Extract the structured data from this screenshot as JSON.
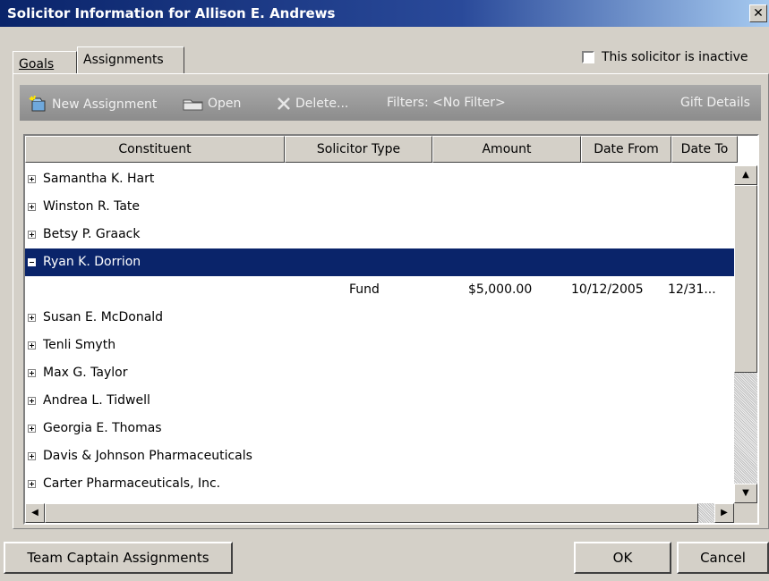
{
  "window": {
    "title": "Solicitor Information for Allison E. Andrews",
    "close_glyph": "✕"
  },
  "tabs": [
    {
      "label": "Goals",
      "mnemonic": "G"
    },
    {
      "label": "Assignments",
      "mnemonic": "A"
    }
  ],
  "inactive_checkbox": {
    "label": "This solicitor is inactive",
    "checked": false
  },
  "toolbar": {
    "new_assignment": "New Assignment",
    "open": "Open",
    "delete": "Delete...",
    "filters": "Filters: <No Filter>",
    "gift_details": "Gift Details"
  },
  "grid": {
    "columns": [
      "Constituent",
      "Solicitor Type",
      "Amount",
      "Date From",
      "Date To"
    ],
    "rows": [
      {
        "name": "Samantha K. Hart",
        "expanded": false
      },
      {
        "name": "Winston R. Tate",
        "expanded": false
      },
      {
        "name": "Betsy P. Graack",
        "expanded": false
      },
      {
        "name": "Ryan K. Dorrion",
        "expanded": true,
        "selected": true
      },
      {
        "detail": true,
        "solicitor_type": "Fund",
        "amount": "$5,000.00",
        "date_from": "10/12/2005",
        "date_to": "12/31..."
      },
      {
        "name": "Susan E. McDonald",
        "expanded": false
      },
      {
        "name": "Tenli Smyth",
        "expanded": false
      },
      {
        "name": "Max G. Taylor",
        "expanded": false
      },
      {
        "name": "Andrea L. Tidwell",
        "expanded": false
      },
      {
        "name": "Georgia E. Thomas",
        "expanded": false
      },
      {
        "name": "Davis & Johnson Pharmaceuticals",
        "expanded": false
      },
      {
        "name": "Carter Pharmaceuticals, Inc.",
        "expanded": false
      }
    ]
  },
  "buttons": {
    "team_captain": "Team Captain Assignments",
    "team_captain_mnemonic": "T",
    "ok": "OK",
    "cancel": "Cancel"
  },
  "colors": {
    "title_bar": "#0a246a",
    "selected_row": "#0a246a",
    "face": "#d4d0c8"
  }
}
